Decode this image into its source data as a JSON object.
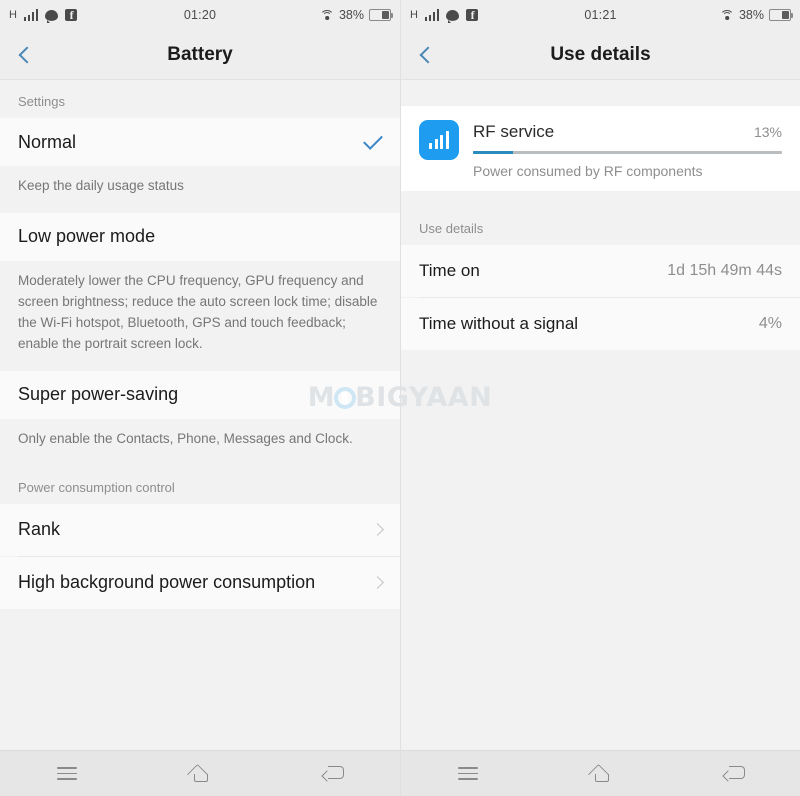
{
  "watermark": {
    "pre": "M",
    "post": "BIGYAAN"
  },
  "left": {
    "statusbar": {
      "network_type": "H",
      "time": "01:20",
      "battery_percent": "38%",
      "icons": [
        "signal-bars-icon",
        "chat-bubble-icon",
        "facebook-icon",
        "wifi-icon",
        "battery-icon"
      ]
    },
    "title": "Battery",
    "back_icon": "chevron-left-icon",
    "sections": [
      {
        "label": "Settings"
      }
    ],
    "settings_label": "Settings",
    "modes": [
      {
        "name": "Normal",
        "description": "Keep the daily usage status",
        "selected": true
      },
      {
        "name": "Low power mode",
        "description": "Moderately lower the CPU frequency, GPU frequency and screen brightness; reduce the auto screen lock time; disable the Wi-Fi hotspot, Bluetooth, GPS and touch feedback; enable the portrait screen lock.",
        "selected": false
      },
      {
        "name": "Super power-saving",
        "description": "Only enable the Contacts, Phone, Messages and Clock.",
        "selected": false
      }
    ],
    "power_control_label": "Power consumption control",
    "links": [
      {
        "label": "Rank"
      },
      {
        "label": "High background power consumption"
      }
    ]
  },
  "right": {
    "statusbar": {
      "network_type": "H",
      "time": "01:21",
      "battery_percent": "38%"
    },
    "title": "Use details",
    "back_icon": "chevron-left-icon",
    "app": {
      "icon": "signal-bars-app-icon",
      "name": "RF service",
      "percent": "13%",
      "percent_value": 13,
      "subtitle": "Power consumed by RF components"
    },
    "details_label": "Use details",
    "details": [
      {
        "label": "Time on",
        "value": "1d 15h 49m 44s"
      },
      {
        "label": "Time without a signal",
        "value": "4%"
      }
    ]
  },
  "navbar": {
    "menu_icon": "menu-icon",
    "home_icon": "home-icon",
    "back_icon": "back-icon"
  },
  "colors": {
    "accent_blue": "#3d87c8",
    "app_icon_blue": "#1e9cf0",
    "progress_blue": "#2a8bbd"
  }
}
